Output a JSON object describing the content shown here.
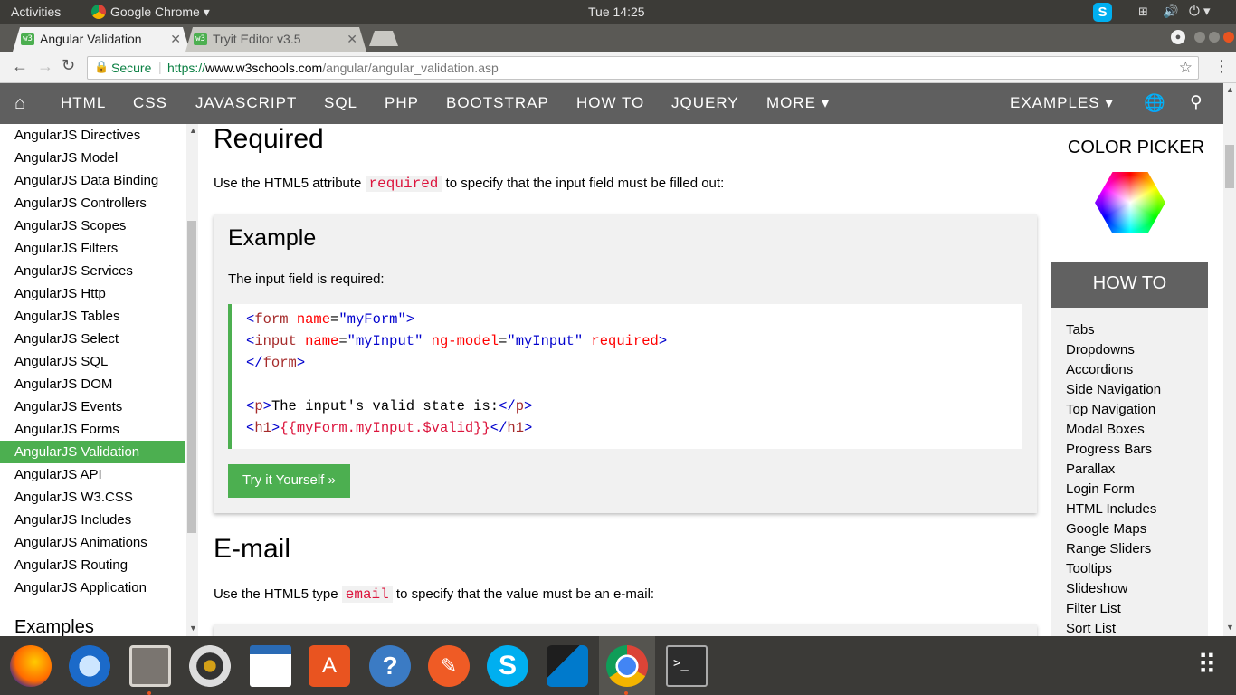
{
  "topbar": {
    "activities": "Activities",
    "app": "Google Chrome",
    "clock": "Tue 14:25"
  },
  "tabs": [
    {
      "label": "Angular Validation",
      "favicon": "w3",
      "active": true
    },
    {
      "label": "Tryit Editor v3.5",
      "favicon": "w3",
      "active": false
    }
  ],
  "toolbar": {
    "secure": "Secure",
    "url_scheme": "https://",
    "url_host": "www.w3schools.com",
    "url_path": "/angular/angular_validation.asp"
  },
  "nav": {
    "items": [
      "HTML",
      "CSS",
      "JAVASCRIPT",
      "SQL",
      "PHP",
      "BOOTSTRAP",
      "HOW TO",
      "JQUERY",
      "MORE ▾"
    ],
    "examples": "EXAMPLES ▾"
  },
  "sidebar": {
    "items": [
      "AngularJS Directives",
      "AngularJS Model",
      "AngularJS Data Binding",
      "AngularJS Controllers",
      "AngularJS Scopes",
      "AngularJS Filters",
      "AngularJS Services",
      "AngularJS Http",
      "AngularJS Tables",
      "AngularJS Select",
      "AngularJS SQL",
      "AngularJS DOM",
      "AngularJS Events",
      "AngularJS Forms",
      "AngularJS Validation",
      "AngularJS API",
      "AngularJS W3.CSS",
      "AngularJS Includes",
      "AngularJS Animations",
      "AngularJS Routing",
      "AngularJS Application"
    ],
    "active_index": 14,
    "section": "Examples"
  },
  "main": {
    "h_required": "Required",
    "p_required_pre": "Use the HTML5 attribute ",
    "p_required_code": "required",
    "p_required_post": " to specify that the input field must be filled out:",
    "example_title": "Example",
    "example_desc": "The input field is required:",
    "try_button": "Try it Yourself »",
    "h_email": "E-mail",
    "p_email_pre": "Use the HTML5 type ",
    "p_email_code": "email",
    "p_email_post": " to specify that the value must be an e-mail:"
  },
  "code": {
    "l1": {
      "open": "<",
      "tag": "form",
      "attr": " name",
      "eq": "=",
      "val": "\"myForm\"",
      "close": ">"
    },
    "l2": {
      "open": "<",
      "tag": "input",
      "a1": " name",
      "eq1": "=",
      "v1": "\"myInput\"",
      "a2": " ng-model",
      "eq2": "=",
      "v2": "\"myInput\"",
      "a3": " required",
      "close": ">"
    },
    "l3": {
      "open": "</",
      "tag": "form",
      "close": ">"
    },
    "l4": {
      "open": "<",
      "tag": "p",
      "close": ">",
      "text": "The input's valid state is:",
      "eopen": "</",
      "etag": "p",
      "eclose": ">"
    },
    "l5": {
      "open": "<",
      "tag": "h1",
      "close": ">",
      "text": "{{myForm.myInput.$valid}}",
      "eopen": "</",
      "etag": "h1",
      "eclose": ">"
    }
  },
  "right": {
    "color_picker": "COLOR PICKER",
    "howto_title": "HOW TO",
    "howto_items": [
      "Tabs",
      "Dropdowns",
      "Accordions",
      "Side Navigation",
      "Top Navigation",
      "Modal Boxes",
      "Progress Bars",
      "Parallax",
      "Login Form",
      "HTML Includes",
      "Google Maps",
      "Range Sliders",
      "Tooltips",
      "Slideshow",
      "Filter List",
      "Sort List"
    ]
  },
  "colors": {
    "w3_green": "#4caf50",
    "nav_gray": "#5f5f5f",
    "topbar": "#3c3b37",
    "dock": "#3b3a37"
  },
  "dock": {
    "icons": [
      "firefox-icon",
      "thunderbird-icon",
      "files-icon",
      "rhythmbox-icon",
      "writer-icon",
      "software-center-icon",
      "help-icon",
      "postman-icon",
      "skype-icon",
      "vscode-icon",
      "chrome-icon",
      "terminal-icon",
      "app-grid-icon"
    ]
  }
}
